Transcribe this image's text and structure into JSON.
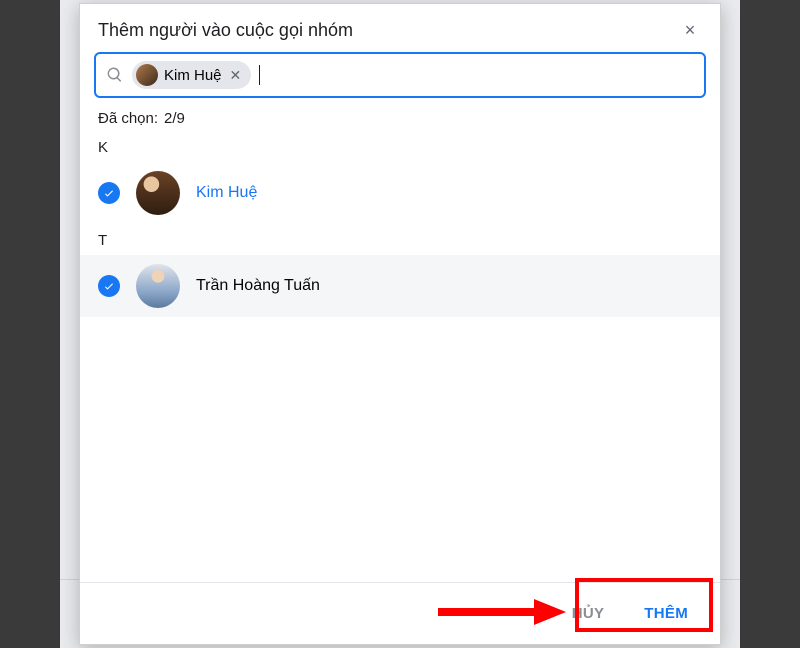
{
  "dialog": {
    "title": "Thêm người vào cuộc gọi nhóm",
    "close_label": "×"
  },
  "search": {
    "placeholder": "",
    "value": "",
    "chip_name": "Kim Huệ",
    "chip_remove": "✕"
  },
  "selection": {
    "label": "Đã chọn:",
    "count": "2/9"
  },
  "sections": [
    {
      "letter": "K",
      "items": [
        {
          "name": "Kim Huệ",
          "checked": true,
          "highlight": false,
          "avatar": "av1",
          "name_style": "selected"
        }
      ]
    },
    {
      "letter": "T",
      "items": [
        {
          "name": "Trần Hoàng Tuấn",
          "checked": true,
          "highlight": true,
          "avatar": "av2",
          "name_style": "normal"
        }
      ]
    }
  ],
  "footer": {
    "cancel": "HỦY",
    "add": "THÊM"
  }
}
